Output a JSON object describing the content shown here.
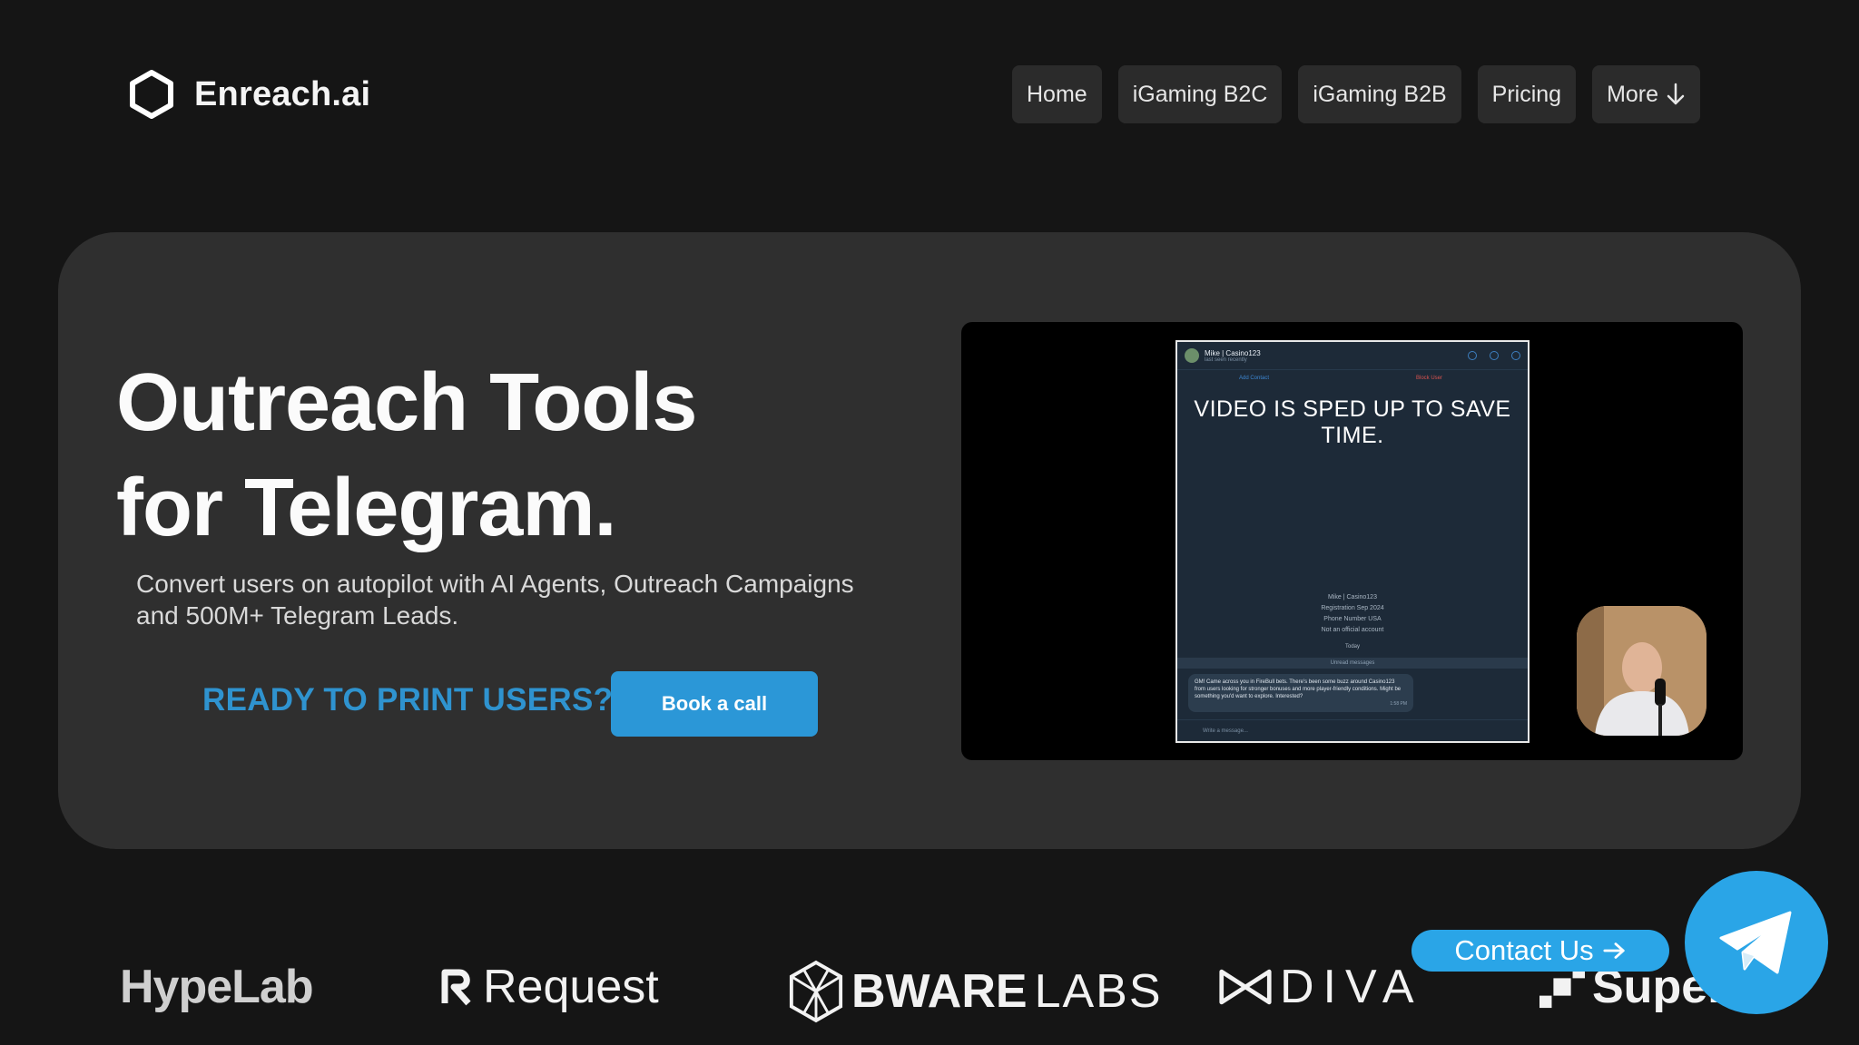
{
  "header": {
    "brand": "Enreach.ai",
    "nav": [
      {
        "label": "Home"
      },
      {
        "label": "iGaming B2C"
      },
      {
        "label": "iGaming B2B"
      },
      {
        "label": "Pricing"
      },
      {
        "label": "More"
      }
    ]
  },
  "hero": {
    "title_line1": "Outreach Tools",
    "title_line2": "for Telegram.",
    "subtitle_line1": "Convert users on autopilot with AI Agents, Outreach Campaigns",
    "subtitle_line2": "and 500M+ Telegram Leads.",
    "cta_text": "READY TO PRINT USERS?",
    "cta_button": "Book a call"
  },
  "video": {
    "overlay_text": "VIDEO IS SPED UP TO SAVE TIME.",
    "chat_name": "Mike | Casino123",
    "last_seen": "last seen recently",
    "add_contact": "Add Contact",
    "block_user": "Block User",
    "card_name": "Mike | Casino123",
    "registration": "Registration  Sep 2024",
    "phone": "Phone Number  USA",
    "not_official": "Not an official account",
    "today": "Today",
    "unread": "Unread messages",
    "message": "GM! Came across you in FireBull bets. There's been some buzz around Casino123 from users looking for stronger bonuses and more player-friendly conditions. Might be something you'd want to explore. Interested?",
    "message_time": "1:58 PM",
    "input_placeholder": "Write a message..."
  },
  "partners": {
    "hypelab": "HypeLab",
    "request": "Request",
    "bware_bold": "BWARE",
    "bware_light": "LABS",
    "diva": "DIVA",
    "super": "Super"
  },
  "contact": {
    "label": "Contact Us"
  },
  "colors": {
    "background": "#151515",
    "card": "#2f2f2f",
    "accent": "#2b97d7",
    "telegram": "#2aa5e7"
  }
}
